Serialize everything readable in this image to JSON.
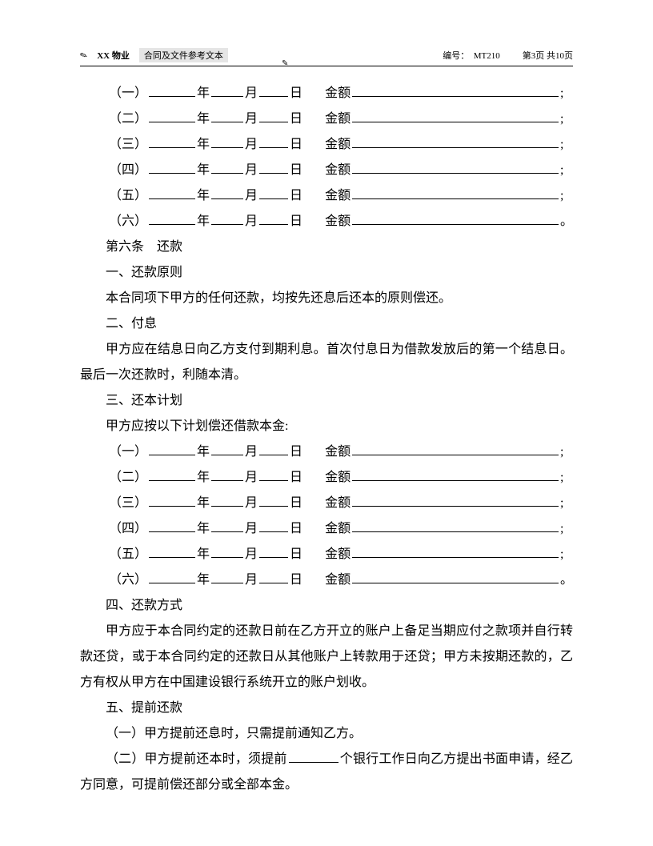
{
  "header": {
    "company": "XX 物业",
    "doctype": "合同及文件参考文本",
    "code_label": "编号：",
    "code_value": "MT210",
    "page_info": "第3页 共10页",
    "pointer": "✎"
  },
  "labels": {
    "year": "年",
    "month": "月",
    "day": "日",
    "amount": "金额",
    "semicolon": ";",
    "period": "。",
    "items": [
      "（一）",
      "（二）",
      "（三）",
      "（四）",
      "（五）",
      "（六）"
    ]
  },
  "sections": {
    "article6": "第六条　还款",
    "sub1_title": "一、还款原则",
    "sub1_para": "本合同项下甲方的任何还款，均按先还息后还本的原则偿还。",
    "sub2_title": "二、付息",
    "sub2_para": "甲方应在结息日向乙方支付到期利息。首次付息日为借款发放后的第一个结息日。最后一次还款时，利随本清。",
    "sub3_title": "三、还本计划",
    "sub3_intro": "甲方应按以下计划偿还借款本金:",
    "sub4_title": "四、还款方式",
    "sub4_para": "甲方应于本合同约定的还款日前在乙方开立的账户上备足当期应付之款项并自行转款还贷，或于本合同约定的还款日从其他账户上转款用于还贷；甲方未按期还款的，乙方有权从甲方在中国建设银行系统开立的账户划收。",
    "sub5_title": "五、提前还款",
    "sub5_item1": "（一）甲方提前还息时，只需提前通知乙方。",
    "sub5_item2_before": "（二）甲方提前还本时，须提前",
    "sub5_item2_after": "个银行工作日向乙方提出书面申请，经乙方同意，可提前偿还部分或全部本金。"
  }
}
